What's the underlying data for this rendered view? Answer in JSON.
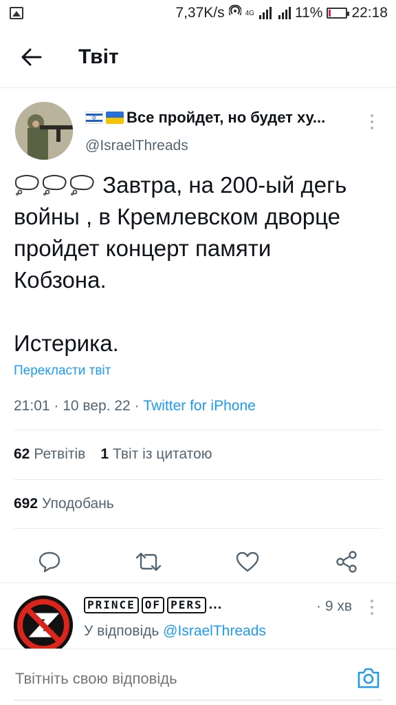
{
  "status_bar": {
    "speed": "7,37K/s",
    "network": "4G",
    "battery": "11%",
    "time": "22:18"
  },
  "header": {
    "title": "Твіт"
  },
  "tweet": {
    "author_name": "Все пройдет, но будет ху...",
    "author_handle": "@IsraelThreads",
    "text_line1": "Завтра, на 200-ый дегь\nвойны , в Кремлевском дворце\nпройдет концерт памяти\nКобзона.",
    "text_line2": "Истерика.",
    "translate_label": "Перекласти твіт",
    "time": "21:01",
    "date": "10 вер. 22",
    "source": "Twitter for iPhone",
    "retweets_count": "62",
    "retweets_label": "Ретвітів",
    "quotes_count": "1",
    "quotes_label": "Твіт із цитатою",
    "likes_count": "692",
    "likes_label": "Уподобань"
  },
  "reply": {
    "name_words": [
      "PRINCE",
      "OF",
      "PERS"
    ],
    "name_ellipsis": "...",
    "time": "· 9 хв",
    "reply_to_label": "У відповідь",
    "reply_to_handle": "@IsraelThreads"
  },
  "compose": {
    "placeholder": "Твітніть свою відповідь"
  },
  "icons": {
    "back": "arrow-left-icon",
    "more": "more-vertical-icon",
    "reply": "comment-icon",
    "retweet": "retweet-icon",
    "like": "heart-icon",
    "share": "share-icon",
    "camera": "camera-icon"
  },
  "colors": {
    "accent": "#1d9bf0",
    "text": "#0f1419",
    "secondary": "#536471",
    "divider": "#e6ecf0"
  }
}
